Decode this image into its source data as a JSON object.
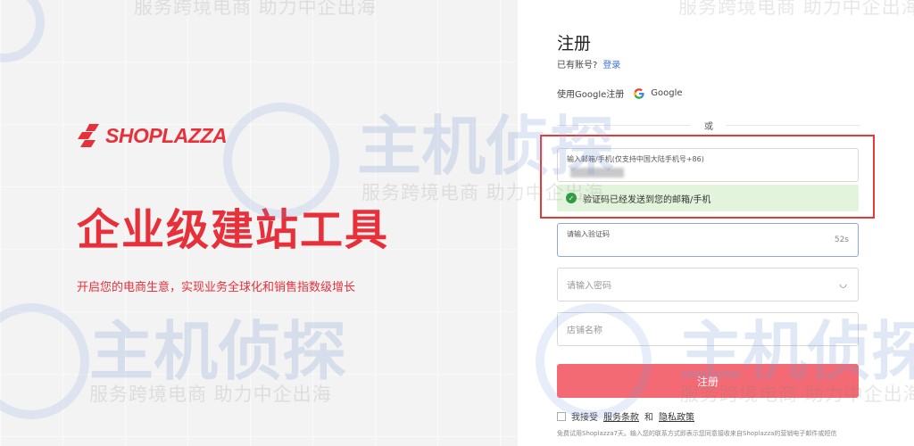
{
  "brand": {
    "name": "SHOPLAZZA",
    "color": "#e8303b"
  },
  "hero": {
    "headline": "企业级建站工具",
    "subline": "开启您的电商生意，实现业务全球化和销售指数级增长"
  },
  "form": {
    "title": "注册",
    "have_account": "已有账号?",
    "login_link": "登录",
    "google_prefix": "使用Google注册",
    "google_label": "Google",
    "google_icon": "google-g-icon",
    "or": "或",
    "email_label": "输入邮箱/手机(仅支持中国大陆手机号+86)",
    "toast": "验证码已经发送到您的邮箱/手机",
    "code_label": "请输入验证码",
    "code_timer": "52s",
    "password_placeholder": "请输入密码",
    "store_placeholder": "店铺名称",
    "submit": "注册",
    "agree_prefix": "我接受",
    "terms": "服务条款",
    "and": "和",
    "privacy": "隐私政策",
    "footnote": "免费试用Shoplazza7天。输入您的联系方式即表示您同意接收来自Shoplazza的营销电子邮件或短信"
  },
  "watermark": {
    "big": "主机侦探",
    "small": "服务跨境电商  助力中企出海"
  },
  "colors": {
    "accent": "#e8303b",
    "submit": "#f46a74",
    "link": "#3a6fd8",
    "success": "#2f9e41",
    "highlight": "#e53935"
  }
}
